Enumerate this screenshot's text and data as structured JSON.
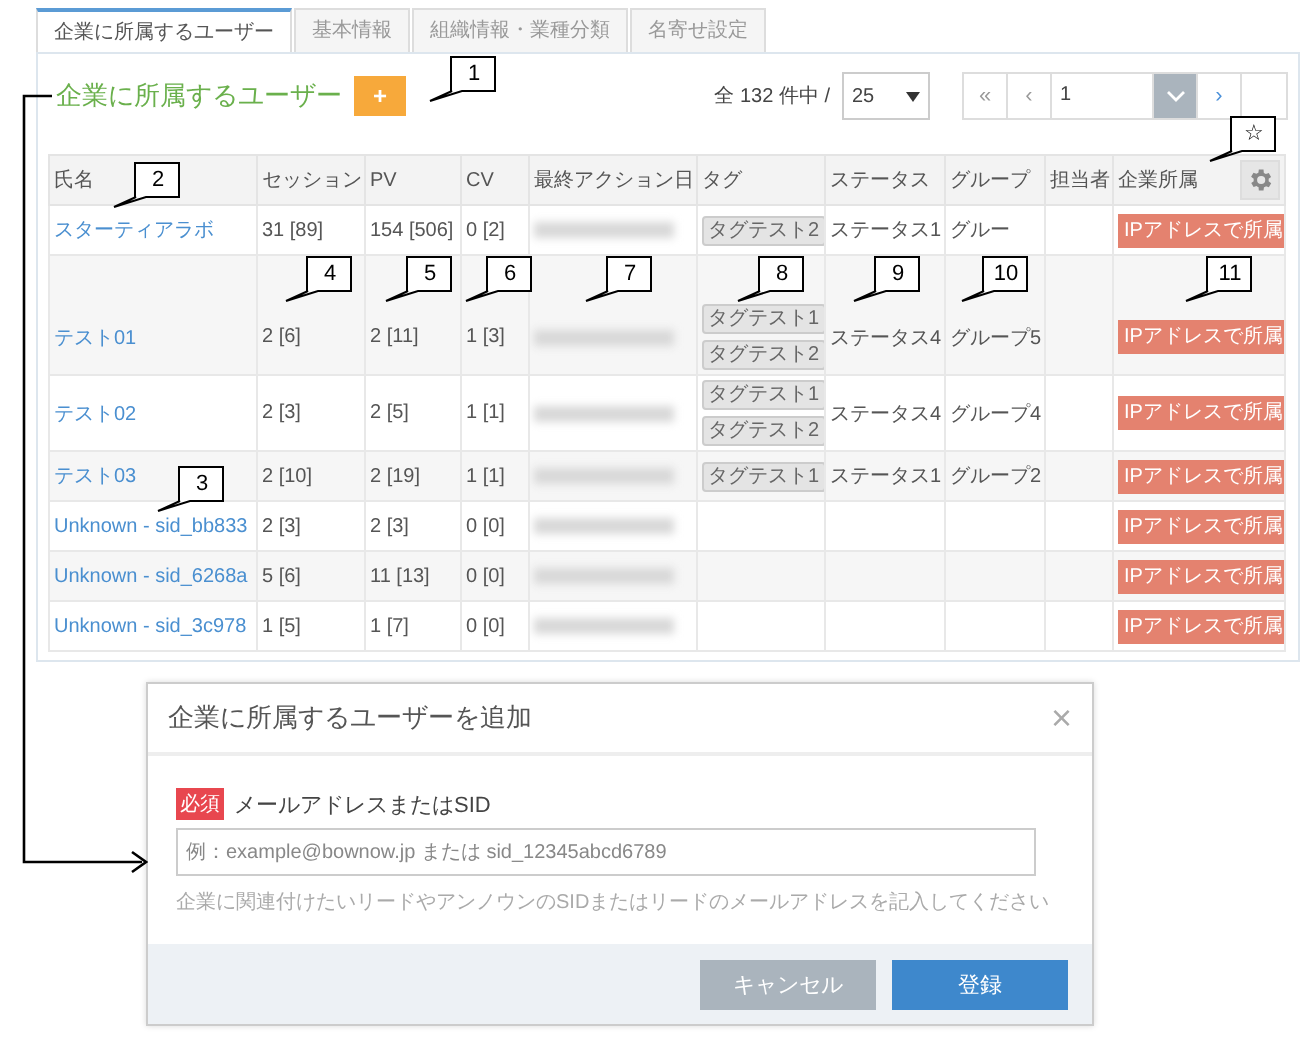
{
  "tabs": [
    {
      "label": "企業に所属するユーザー",
      "selected": true
    },
    {
      "label": "基本情報",
      "selected": false
    },
    {
      "label": "組織情報・業種分類",
      "selected": false
    },
    {
      "label": "名寄せ設定",
      "selected": false
    }
  ],
  "section": {
    "title": "企業に所属するユーザー",
    "add_button": "+"
  },
  "pagination": {
    "total": "全 132 件中 /",
    "per_page": "25",
    "first": "«",
    "prev": "‹",
    "page": "1",
    "next": "›"
  },
  "table": {
    "columns": [
      "氏名",
      "セッション",
      "PV",
      "CV",
      "最終アクション日",
      "タグ",
      "ステータス",
      "グループ",
      "担当者",
      "企業所属"
    ],
    "rows": [
      {
        "name": "スターティアラボ",
        "session": "31 [89]",
        "pv": "154 [506]",
        "cv": "0 [2]",
        "tags": [
          "タグテスト2"
        ],
        "status": "ステータス1",
        "group": "グルー",
        "affiliation": "IPアドレスで所属"
      },
      {
        "name": "テスト01",
        "session": "2 [6]",
        "pv": "2 [11]",
        "cv": "1 [3]",
        "tags": [
          "タグテスト1",
          "タグテスト2"
        ],
        "status": "ステータス4",
        "group": "グループ5",
        "affiliation": "IPアドレスで所属"
      },
      {
        "name": "テスト02",
        "session": "2 [3]",
        "pv": "2 [5]",
        "cv": "1 [1]",
        "tags": [
          "タグテスト1",
          "タグテスト2"
        ],
        "status": "ステータス4",
        "group": "グループ4",
        "affiliation": "IPアドレスで所属"
      },
      {
        "name": "テスト03",
        "session": "2 [10]",
        "pv": "2 [19]",
        "cv": "1 [1]",
        "tags": [
          "タグテスト1"
        ],
        "status": "ステータス1",
        "group": "グループ2",
        "affiliation": "IPアドレスで所属"
      },
      {
        "name": "Unknown - sid_bb833",
        "session": "2 [3]",
        "pv": "2 [3]",
        "cv": "0 [0]",
        "tags": [],
        "status": "",
        "group": "",
        "affiliation": "IPアドレスで所属"
      },
      {
        "name": "Unknown - sid_6268a",
        "session": "5 [6]",
        "pv": "11 [13]",
        "cv": "0 [0]",
        "tags": [],
        "status": "",
        "group": "",
        "affiliation": "IPアドレスで所属"
      },
      {
        "name": "Unknown - sid_3c978",
        "session": "1 [5]",
        "pv": "1 [7]",
        "cv": "0 [0]",
        "tags": [],
        "status": "",
        "group": "",
        "affiliation": "IPアドレスで所属"
      }
    ]
  },
  "dialog": {
    "title": "企業に所属するユーザーを追加",
    "close": "×",
    "required_badge": "必須",
    "field_label": "メールアドレスまたはSID",
    "placeholder": "例：example@bownow.jp または sid_12345abcd6789",
    "help": "企業に関連付けたいリードやアンノウンのSIDまたはリードのメールアドレスを記入してください",
    "buttons": [
      {
        "label": "キャンセル",
        "kind": "cancel"
      },
      {
        "label": "登録",
        "kind": "primary"
      }
    ]
  },
  "annotations": [
    "1",
    "2",
    "3",
    "4",
    "5",
    "6",
    "7",
    "8",
    "9",
    "10",
    "11",
    "☆"
  ]
}
